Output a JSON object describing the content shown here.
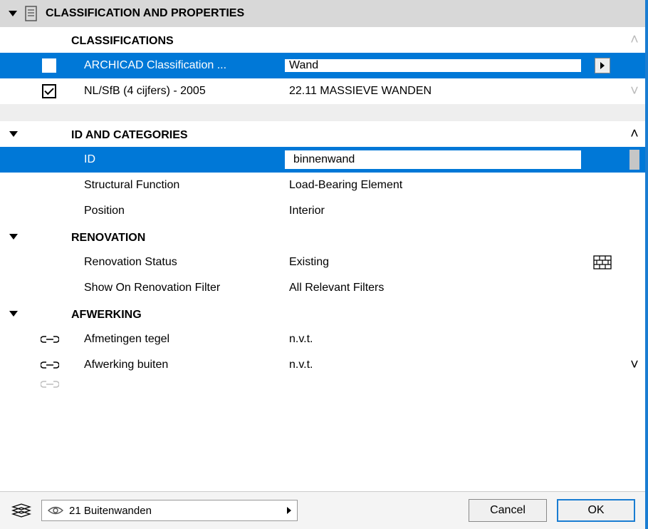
{
  "section": {
    "title": "CLASSIFICATION AND PROPERTIES"
  },
  "classifications": {
    "heading": "CLASSIFICATIONS",
    "rows": [
      {
        "label": "ARCHICAD Classification ...",
        "value": "Wand",
        "checked": true,
        "selected": true
      },
      {
        "label": "NL/SfB (4 cijfers) - 2005",
        "value": "22.11 MASSIEVE WANDEN",
        "checked": true,
        "selected": false
      }
    ]
  },
  "id_and_categories": {
    "heading": "ID AND CATEGORIES",
    "rows": [
      {
        "label": "ID",
        "value": "binnenwand",
        "selected": true
      },
      {
        "label": "Structural Function",
        "value": "Load-Bearing Element",
        "selected": false
      },
      {
        "label": "Position",
        "value": "Interior",
        "selected": false
      }
    ]
  },
  "renovation": {
    "heading": "RENOVATION",
    "rows": [
      {
        "label": "Renovation Status",
        "value": "Existing",
        "icon": "brick"
      },
      {
        "label": "Show On Renovation Filter",
        "value": "All Relevant Filters"
      }
    ]
  },
  "afwerking": {
    "heading": "AFWERKING",
    "rows": [
      {
        "label": "Afmetingen tegel",
        "value": "n.v.t.",
        "linked": true
      },
      {
        "label": "Afwerking buiten",
        "value": "n.v.t.",
        "linked": true
      }
    ]
  },
  "footer": {
    "layer": "21 Buitenwanden",
    "cancel": "Cancel",
    "ok": "OK"
  }
}
